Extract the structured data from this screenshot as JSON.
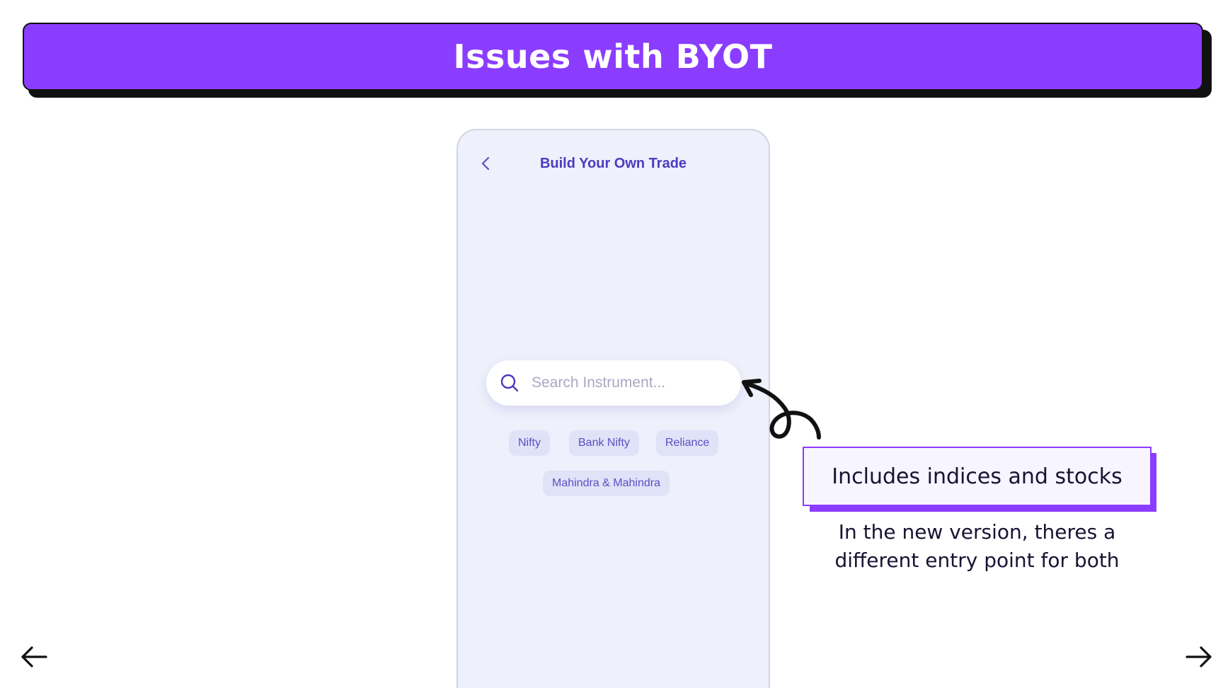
{
  "slide": {
    "title": "Issues with BYOT"
  },
  "phone": {
    "header": {
      "title": "Build Your Own Trade",
      "back_icon": "chevron-left-icon"
    },
    "search": {
      "placeholder": "Search Instrument...",
      "value": "",
      "icon": "search-icon"
    },
    "chips": [
      {
        "label": "Nifty"
      },
      {
        "label": "Bank Nifty"
      },
      {
        "label": "Reliance"
      },
      {
        "label": "Mahindra & Mahindra"
      }
    ]
  },
  "annotation": {
    "callout": "Includes indices and stocks",
    "note_line1": "In the new version, theres a",
    "note_line2": "different entry point for both"
  },
  "navigation": {
    "prev_icon": "arrow-left-icon",
    "next_icon": "arrow-right-icon"
  },
  "colors": {
    "accent": "#8b3dff",
    "phone_bg": "#eef0fb",
    "chip_bg": "#e0e2f8",
    "chip_text": "#5a4fc4",
    "header_text": "#4b3bbf"
  }
}
